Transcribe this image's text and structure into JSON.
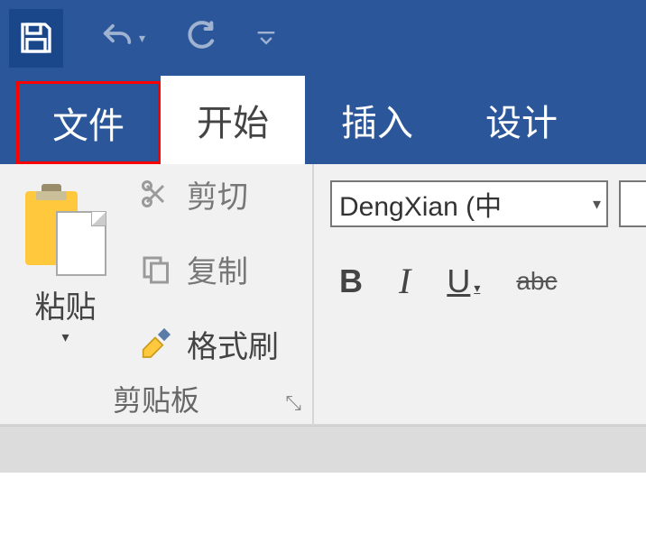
{
  "qat": {
    "save": "save",
    "undo": "undo",
    "redo": "redo",
    "customize": "customize"
  },
  "tabs": {
    "file": "文件",
    "home": "开始",
    "insert": "插入",
    "design": "设计"
  },
  "clipboard": {
    "paste": "粘贴",
    "cut": "剪切",
    "copy": "复制",
    "format_painter": "格式刷",
    "group_label": "剪贴板"
  },
  "font": {
    "name": "DengXian (中",
    "bold": "B",
    "italic": "I",
    "underline": "U",
    "strike": "abc"
  }
}
